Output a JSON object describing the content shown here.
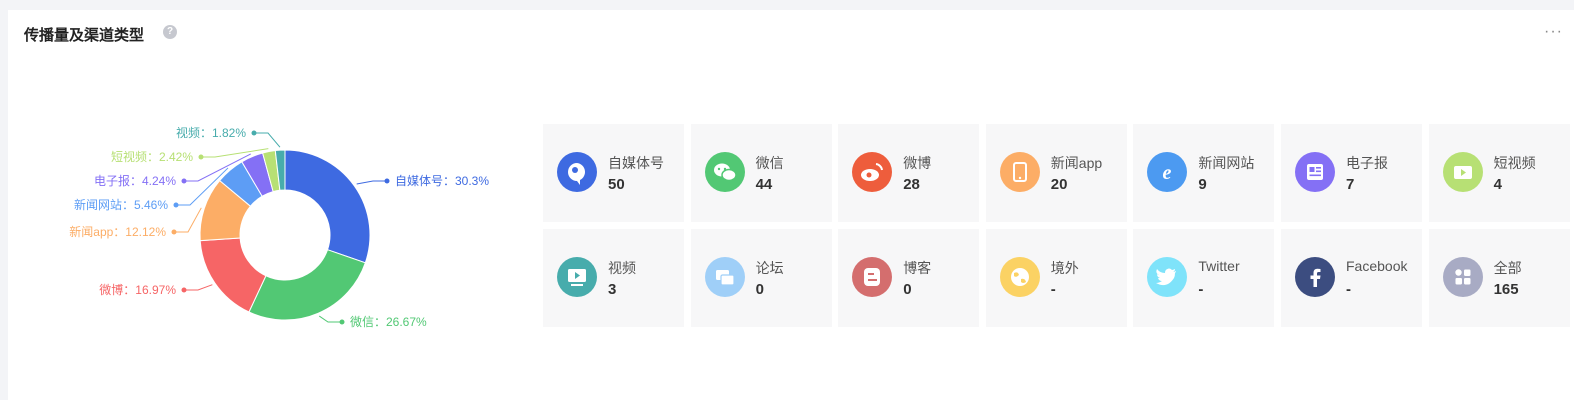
{
  "header": {
    "title": "传播量及渠道类型",
    "help_icon": "question-circle-icon",
    "help_glyph": "?",
    "more_icon": "more-ellipsis-icon",
    "more_glyph": "···"
  },
  "chart_data": {
    "type": "pie",
    "variant": "donut",
    "slices": [
      {
        "name": "自媒体号",
        "label": "自媒体号：30.3%",
        "value": 30.3,
        "color": "#3e6ae1"
      },
      {
        "name": "微信",
        "label": "微信：26.67%",
        "value": 26.67,
        "color": "#52c874"
      },
      {
        "name": "微博",
        "label": "微博：16.97%",
        "value": 16.97,
        "color": "#f66566"
      },
      {
        "name": "新闻app",
        "label": "新闻app：12.12%",
        "value": 12.12,
        "color": "#fcad66"
      },
      {
        "name": "新闻网站",
        "label": "新闻网站：5.46%",
        "value": 5.46,
        "color": "#5d9df5"
      },
      {
        "name": "电子报",
        "label": "电子报：4.24%",
        "value": 4.24,
        "color": "#8470f5"
      },
      {
        "name": "短视频",
        "label": "短视频：2.42%",
        "value": 2.42,
        "color": "#b7e074"
      },
      {
        "name": "视频",
        "label": "视频：1.82%",
        "value": 1.82,
        "color": "#47acac"
      }
    ]
  },
  "channels": [
    {
      "label": "自媒体号",
      "value": "50",
      "icon": "self-media-icon",
      "color": "#3e6ae1"
    },
    {
      "label": "微信",
      "value": "44",
      "icon": "wechat-icon",
      "color": "#52c874"
    },
    {
      "label": "微博",
      "value": "28",
      "icon": "weibo-icon",
      "color": "#ee5d3c"
    },
    {
      "label": "新闻app",
      "value": "20",
      "icon": "news-app-icon",
      "color": "#fcad66"
    },
    {
      "label": "新闻网站",
      "value": "9",
      "icon": "news-website-icon",
      "color": "#4c9af1"
    },
    {
      "label": "电子报",
      "value": "7",
      "icon": "e-newspaper-icon",
      "color": "#8470f5"
    },
    {
      "label": "短视频",
      "value": "4",
      "icon": "short-video-icon",
      "color": "#b7e074"
    },
    {
      "label": "视频",
      "value": "3",
      "icon": "video-icon",
      "color": "#47acac"
    },
    {
      "label": "论坛",
      "value": "0",
      "icon": "forum-icon",
      "color": "#9fcff8"
    },
    {
      "label": "博客",
      "value": "0",
      "icon": "blog-icon",
      "color": "#d46e6e"
    },
    {
      "label": "境外",
      "value": "-",
      "icon": "globe-icon",
      "color": "#fbd264"
    },
    {
      "label": "Twitter",
      "value": "-",
      "icon": "twitter-icon",
      "color": "#7fe3fa"
    },
    {
      "label": "Facebook",
      "value": "-",
      "icon": "facebook-icon",
      "color": "#3c4d80"
    },
    {
      "label": "全部",
      "value": "165",
      "icon": "all-grid-icon",
      "color": "#a8abc4"
    }
  ]
}
